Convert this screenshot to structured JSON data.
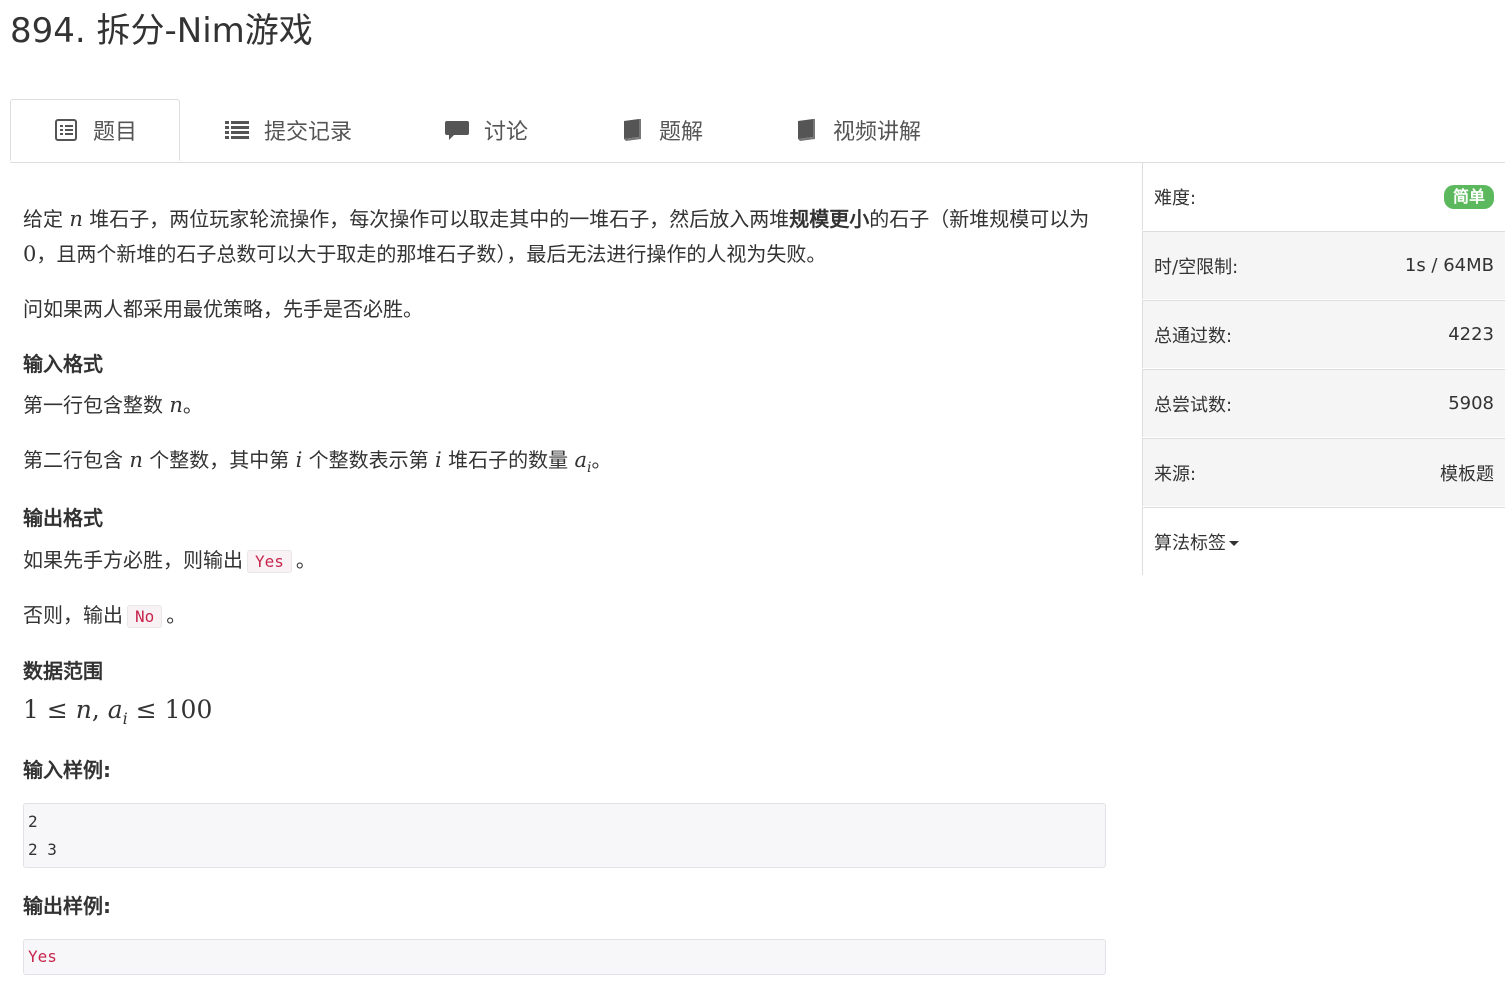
{
  "problem": {
    "title": "894. 拆分-Nim游戏"
  },
  "tabs": [
    {
      "label": "题目",
      "icon": "list-alt-icon",
      "active": true
    },
    {
      "label": "提交记录",
      "icon": "list-icon"
    },
    {
      "label": "讨论",
      "icon": "comment-icon"
    },
    {
      "label": "题解",
      "icon": "book-icon"
    },
    {
      "label": "视频讲解",
      "icon": "book-icon"
    }
  ],
  "statement": {
    "p1_a": "给定 ",
    "p1_var_n": "n",
    "p1_b": " 堆石子，两位玩家轮流操作，每次操作可以取走其中的一堆石子，然后放入两堆",
    "p1_bold": "规模更小",
    "p1_c": "的石子（新堆规模可以为 ",
    "p1_zero": "0",
    "p1_d": "，且两个新堆的石子总数可以大于取走的那堆石子数），最后无法进行操作的人视为失败。",
    "p2": "问如果两人都采用最优策略，先手是否必胜。"
  },
  "input_format": {
    "heading": "输入格式",
    "line1_a": "第一行包含整数 ",
    "line1_var": "n",
    "line1_b": "。",
    "line2_a": "第二行包含 ",
    "line2_var_n": "n",
    "line2_b": " 个整数，其中第 ",
    "line2_var_i": "i",
    "line2_c": " 个整数表示第 ",
    "line2_var_i2": "i",
    "line2_d": " 堆石子的数量 ",
    "line2_var_a": "a",
    "line2_sub": "i",
    "line2_e": "。"
  },
  "output_format": {
    "heading": "输出格式",
    "line1_a": "如果先手方必胜，则输出",
    "line1_code": "Yes",
    "line1_b": "。",
    "line2_a": "否则，输出",
    "line2_code": "No",
    "line2_b": "。"
  },
  "data_range": {
    "heading": "数据范围",
    "one": "1",
    "le1": " ≤ ",
    "n": "n",
    "comma": ", ",
    "a": "a",
    "sub": "i",
    "le2": " ≤ ",
    "hundred": "100"
  },
  "sample_input": {
    "heading": "输入样例:",
    "lines": [
      "2",
      "2 3"
    ]
  },
  "sample_output": {
    "heading": "输出样例:",
    "lines": [
      "Yes"
    ]
  },
  "sidebar": {
    "difficulty_label": "难度:",
    "difficulty_value": "简单",
    "limit_label": "时/空限制:",
    "limit_value": "1s / 64MB",
    "accepted_label": "总通过数:",
    "accepted_value": "4223",
    "attempts_label": "总尝试数:",
    "attempts_value": "5908",
    "source_label": "来源:",
    "source_value": "模板题",
    "tags_label": "算法标签"
  },
  "colors": {
    "badge_green": "#5cb85c",
    "code_red": "#c7254e",
    "border": "#dddddd"
  }
}
